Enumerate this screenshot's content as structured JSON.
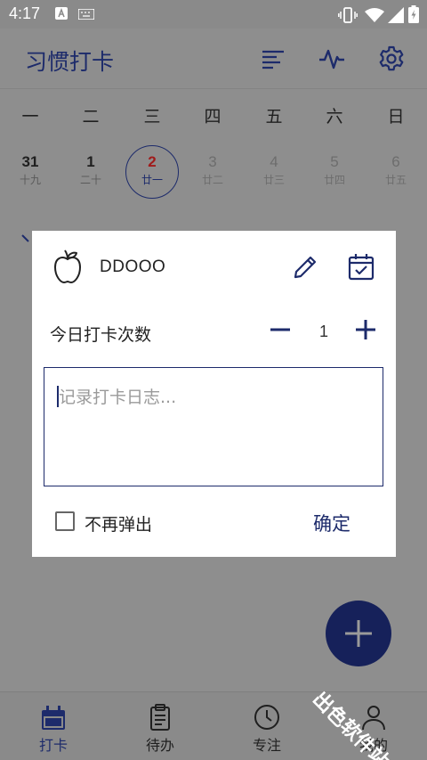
{
  "status_bar": {
    "time": "4:17"
  },
  "app_bar": {
    "title": "习惯打卡"
  },
  "calendar": {
    "weekdays": [
      "一",
      "二",
      "三",
      "四",
      "五",
      "六",
      "日"
    ],
    "dates": [
      {
        "day": "31",
        "lunar": "十九",
        "state": "past"
      },
      {
        "day": "1",
        "lunar": "二十",
        "state": "past"
      },
      {
        "day": "2",
        "lunar": "廿一",
        "state": "today"
      },
      {
        "day": "3",
        "lunar": "廿二",
        "state": "future"
      },
      {
        "day": "4",
        "lunar": "廿三",
        "state": "future"
      },
      {
        "day": "5",
        "lunar": "廿四",
        "state": "future"
      },
      {
        "day": "6",
        "lunar": "廿五",
        "state": "future"
      }
    ]
  },
  "dialog": {
    "habit_name": "DDOOO",
    "count_label": "今日打卡次数",
    "count_value": "1",
    "log_placeholder": "记录打卡日志...",
    "checkbox_label": "不再弹出",
    "confirm_label": "确定"
  },
  "bottom_nav": {
    "items": [
      {
        "label": "打卡",
        "icon": "calendar-icon",
        "active": true
      },
      {
        "label": "待办",
        "icon": "clipboard-icon",
        "active": false
      },
      {
        "label": "专注",
        "icon": "clock-icon",
        "active": false
      },
      {
        "label": "我的",
        "icon": "person-icon",
        "active": false
      }
    ]
  },
  "watermark": "出色软件站",
  "colors": {
    "accent": "#1d2b6b",
    "today_red": "#a01b1b",
    "fab": "#16215a",
    "scrim": "#8e8e8e"
  }
}
